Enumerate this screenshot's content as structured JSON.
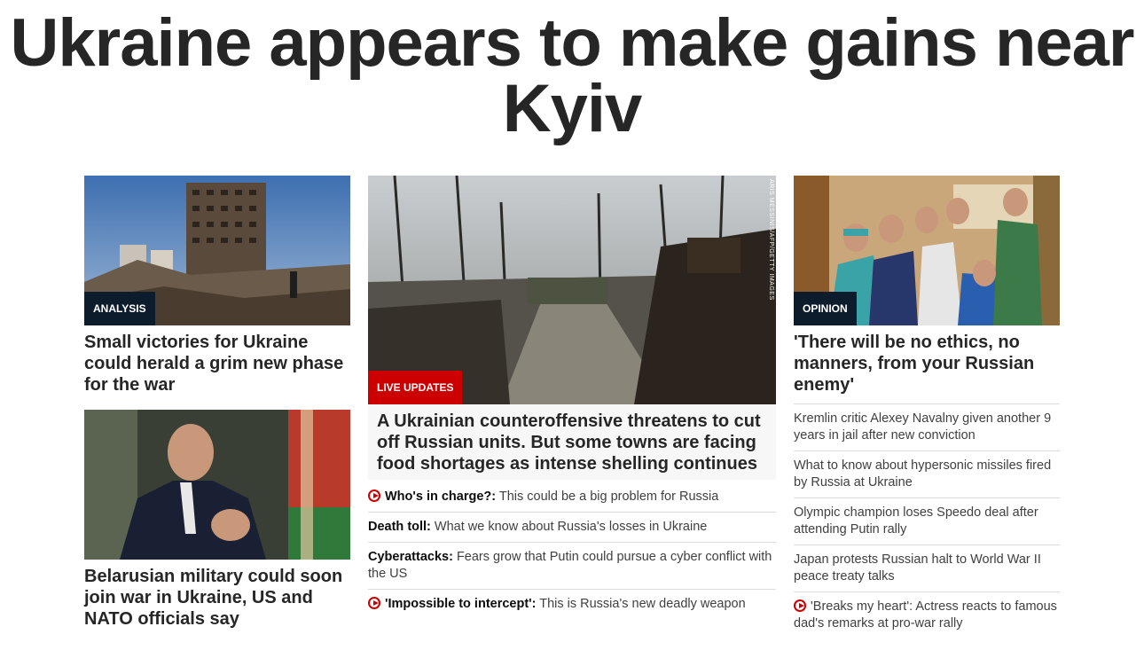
{
  "headline": "Ukraine appears to make gains near Kyiv",
  "left": {
    "story1": {
      "label": "ANALYSIS",
      "title": "Small victories for Ukraine could herald a grim new phase for the war"
    },
    "story2": {
      "title": "Belarusian military could soon join war in Ukraine, US and NATO officials say"
    }
  },
  "center": {
    "label": "LIVE UPDATES",
    "credit": "ARIS MESSINIS/AFP/GETTY IMAGES",
    "title": "A Ukrainian counteroffensive threatens to cut off Russian units. But some towns are facing food shortages as intense shelling continues",
    "items": [
      {
        "bold": "Who's in charge?:",
        "text": " This could be a big problem for Russia",
        "icon": "play-icon"
      },
      {
        "bold": "Death toll:",
        "text": " What we know about Russia's losses in Ukraine",
        "icon": ""
      },
      {
        "bold": "Cyberattacks:",
        "text": " Fears grow that Putin could pursue a cyber conflict with the US",
        "icon": ""
      },
      {
        "bold": "'Impossible to intercept':",
        "text": " This is Russia's new deadly weapon",
        "icon": "play-icon"
      }
    ]
  },
  "right": {
    "label": "OPINION",
    "title": "'There will be no ethics, no manners, from your Russian enemy'",
    "items": [
      {
        "text": "Kremlin critic Alexey Navalny given another 9 years in jail after new conviction",
        "icon": ""
      },
      {
        "text": "What to know about hypersonic missiles fired by Russia at Ukraine",
        "icon": ""
      },
      {
        "text": "Olympic champion loses Speedo deal after attending Putin rally",
        "icon": ""
      },
      {
        "text": "Japan protests Russian halt to World War II peace treaty talks",
        "icon": ""
      },
      {
        "text": "'Breaks my heart': Actress reacts to famous dad's remarks at pro-war rally",
        "icon": "play-icon"
      }
    ]
  },
  "colors": {
    "live_red": "#cc0000",
    "label_navy": "#0c1c2c",
    "headline": "#262626"
  }
}
